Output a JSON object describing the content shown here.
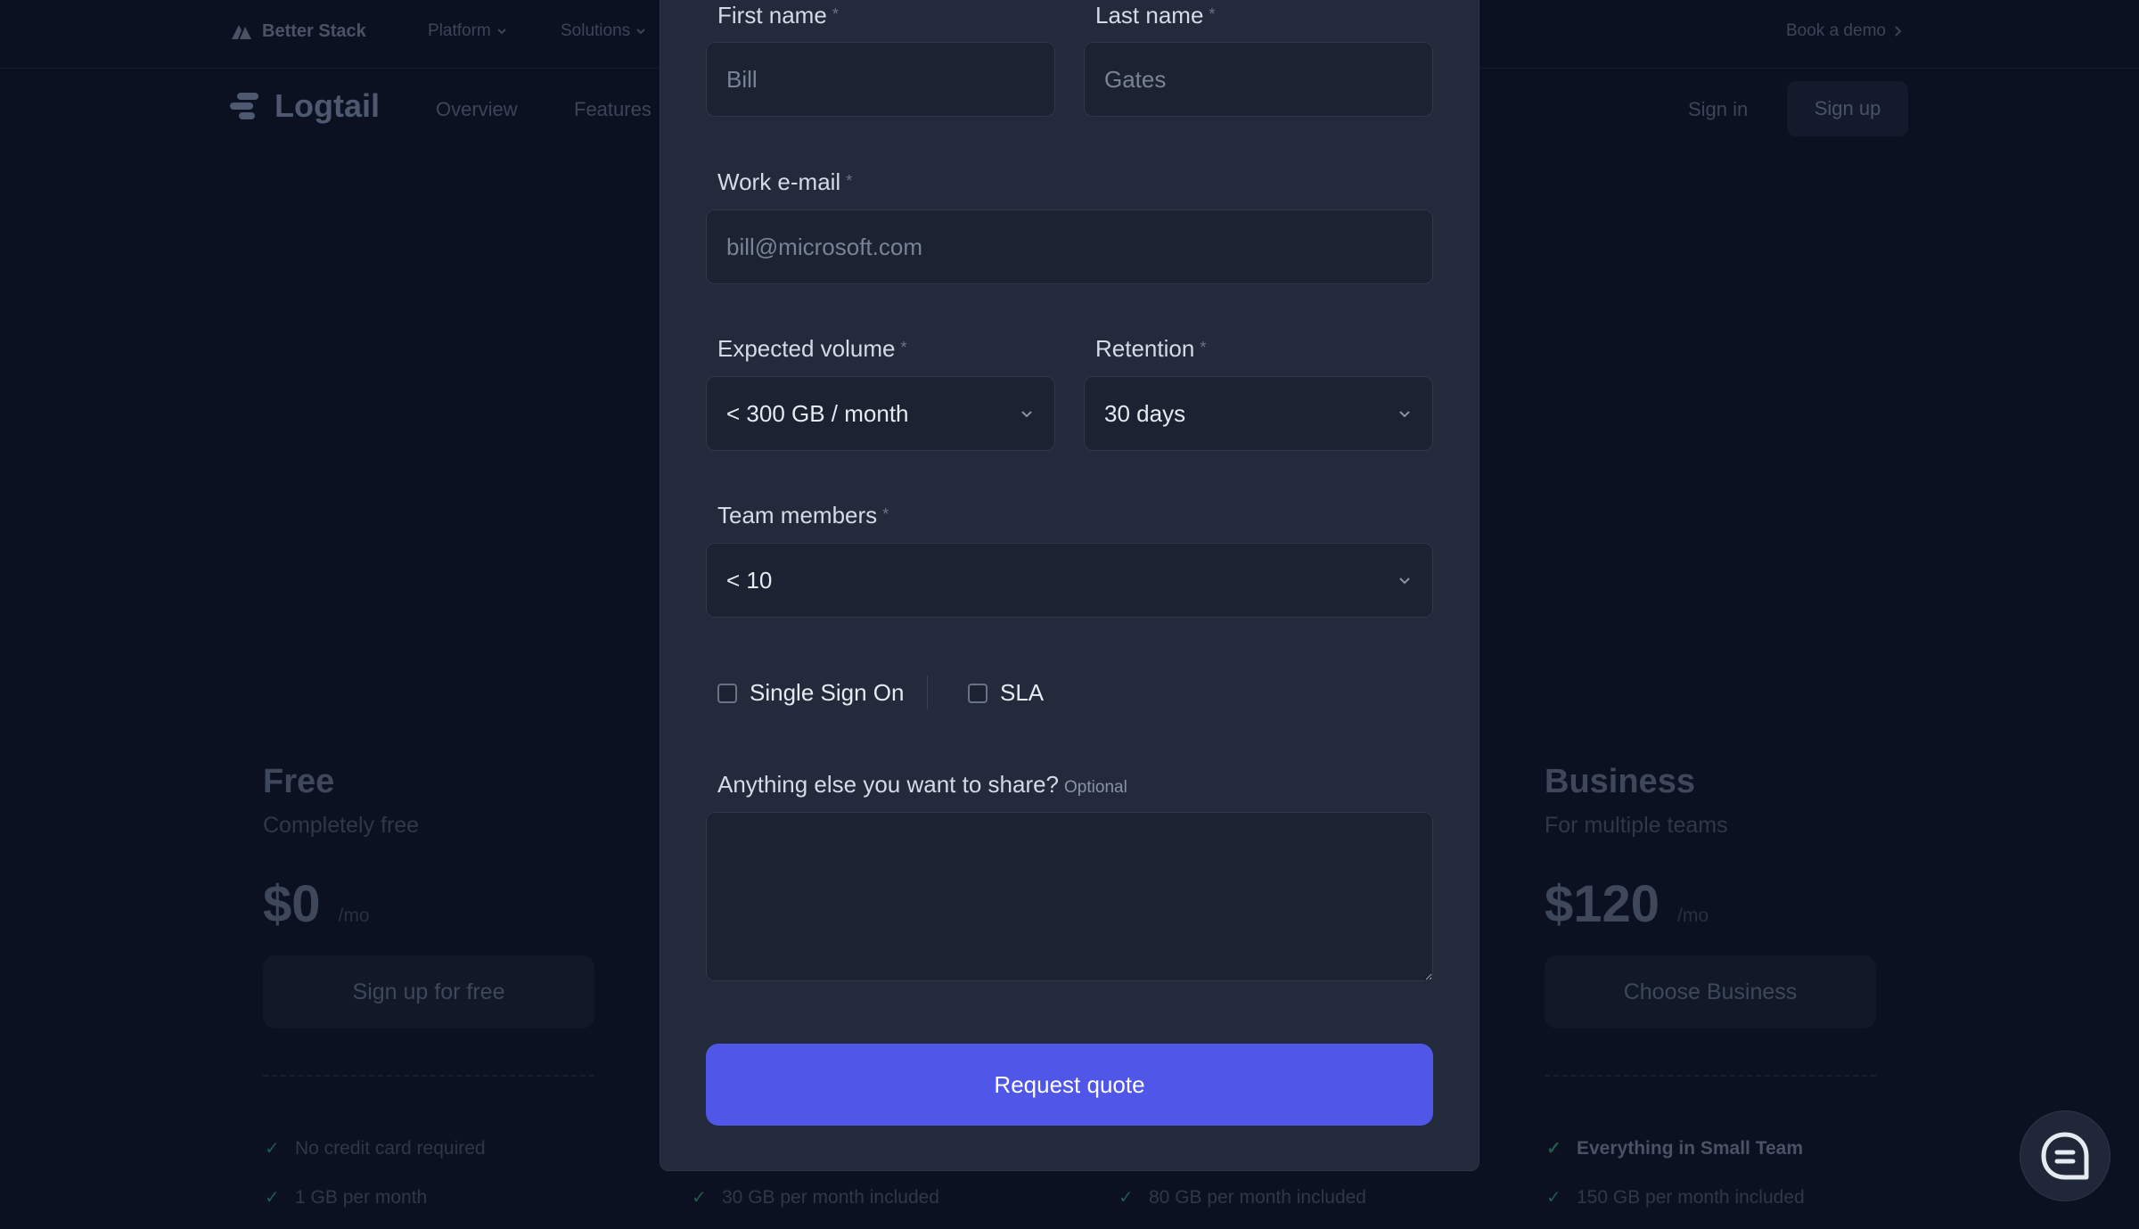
{
  "topbar": {
    "brand": "Better Stack",
    "nav": [
      "Platform",
      "Solutions"
    ],
    "book_demo": "Book a demo"
  },
  "header": {
    "logo": "Logtail",
    "nav": [
      "Overview",
      "Features"
    ],
    "sign_in": "Sign in",
    "sign_up": "Sign up"
  },
  "plans": [
    {
      "name": "Free",
      "subtitle": "Completely free",
      "price": "$0",
      "period": "/mo",
      "button": "Sign up for free",
      "features": [
        "No credit card required",
        "1 GB per month"
      ]
    },
    {
      "name": "Business",
      "subtitle": "For multiple teams",
      "price": "$120",
      "period": "/mo",
      "button": "Choose Business",
      "features": [
        "Everything in Small Team",
        "150 GB per month included"
      ]
    }
  ],
  "hidden_features": [
    "30 GB per month included",
    "80 GB per month included"
  ],
  "form": {
    "first_name": {
      "label": "First name",
      "placeholder": "Bill"
    },
    "last_name": {
      "label": "Last name",
      "placeholder": "Gates"
    },
    "email": {
      "label": "Work e-mail",
      "placeholder": "bill@microsoft.com"
    },
    "volume": {
      "label": "Expected volume",
      "value": "< 300 GB / month"
    },
    "retention": {
      "label": "Retention",
      "value": "30 days"
    },
    "team": {
      "label": "Team members",
      "value": "< 10"
    },
    "sso": {
      "label": "Single Sign On",
      "checked": false
    },
    "sla": {
      "label": "SLA",
      "checked": false
    },
    "notes": {
      "label": "Anything else you want to share?",
      "optional": "Optional"
    },
    "required_mark": "*",
    "submit": "Request quote"
  },
  "icons": {
    "chevron": "chevron-down-icon",
    "check": "check-icon",
    "chat": "chat-icon"
  },
  "colors": {
    "background": "#0b1121",
    "modal": "#222a3b",
    "accent": "#4f56e8",
    "check": "#1f5a4a"
  }
}
